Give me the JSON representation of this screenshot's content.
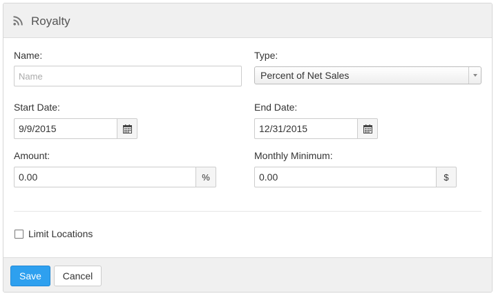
{
  "header": {
    "title": "Royalty",
    "icon": "rss-icon"
  },
  "form": {
    "name": {
      "label": "Name:",
      "value": "",
      "placeholder": "Name"
    },
    "type": {
      "label": "Type:",
      "value": "Percent of Net Sales"
    },
    "start_date": {
      "label": "Start Date:",
      "value": "9/9/2015"
    },
    "end_date": {
      "label": "End Date:",
      "value": "12/31/2015"
    },
    "amount": {
      "label": "Amount:",
      "value": "0.00",
      "suffix": "%"
    },
    "monthly_minimum": {
      "label": "Monthly Minimum:",
      "value": "0.00",
      "suffix": "$"
    },
    "limit_locations": {
      "label": "Limit Locations",
      "checked": false
    }
  },
  "footer": {
    "save_label": "Save",
    "cancel_label": "Cancel"
  },
  "colors": {
    "primary": "#2ea0ef",
    "header_bg": "#f0f0f0",
    "border": "#cccccc"
  }
}
